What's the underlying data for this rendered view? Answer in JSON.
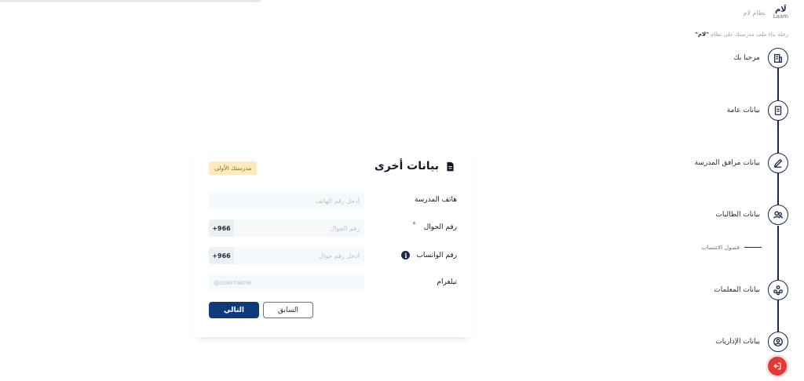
{
  "sidebar": {
    "brand": {
      "logo_ar": "لَام",
      "logo_en": "Laam",
      "name": "نظام لام"
    },
    "tagline_prefix": "رحلة بناء ملف مدرستك على نظام",
    "tagline_brand": "\"لام\"",
    "steps": [
      {
        "label": "مرحبا بك",
        "icon": "building-icon"
      },
      {
        "label": "بيانات عامة",
        "icon": "document-icon"
      },
      {
        "label": "بيانات مرافق المدرسة",
        "icon": "pencil-icon"
      },
      {
        "label": "بيانات الطالبات",
        "icon": "users-icon"
      },
      {
        "label": "بيانات المعلمات",
        "icon": "group-icon"
      },
      {
        "label": "بيانات الإداريات",
        "icon": "person-icon"
      }
    ],
    "sub_step": "فصول الانتساب",
    "logout_icon": "logout-icon"
  },
  "form": {
    "title": "بيانات أخرى",
    "badge": "مدرستك الأولى",
    "fields": {
      "school_phone": {
        "label": "هاتف المدرسة",
        "placeholder": "أدخل رقم الهاتف",
        "value": ""
      },
      "mobile": {
        "label": "رقم الجوال",
        "required_mark": "*",
        "prefix": "+966",
        "placeholder": "رقم الجوال",
        "value": ""
      },
      "whatsapp": {
        "label": "رقم الواتساب",
        "prefix": "+966",
        "placeholder": "أدخل رقم جوال",
        "value": "",
        "info": "i"
      },
      "telegram": {
        "label": "تيلغرام",
        "placeholder": "@username",
        "value": ""
      }
    },
    "buttons": {
      "next": "التالي",
      "previous": "السابق"
    }
  },
  "colors": {
    "primary": "#0f3a7a",
    "navy": "#1a2b4c",
    "badge_bg": "#fcebbf",
    "danger": "#e53935",
    "input_bg": "#f5f9fc"
  }
}
